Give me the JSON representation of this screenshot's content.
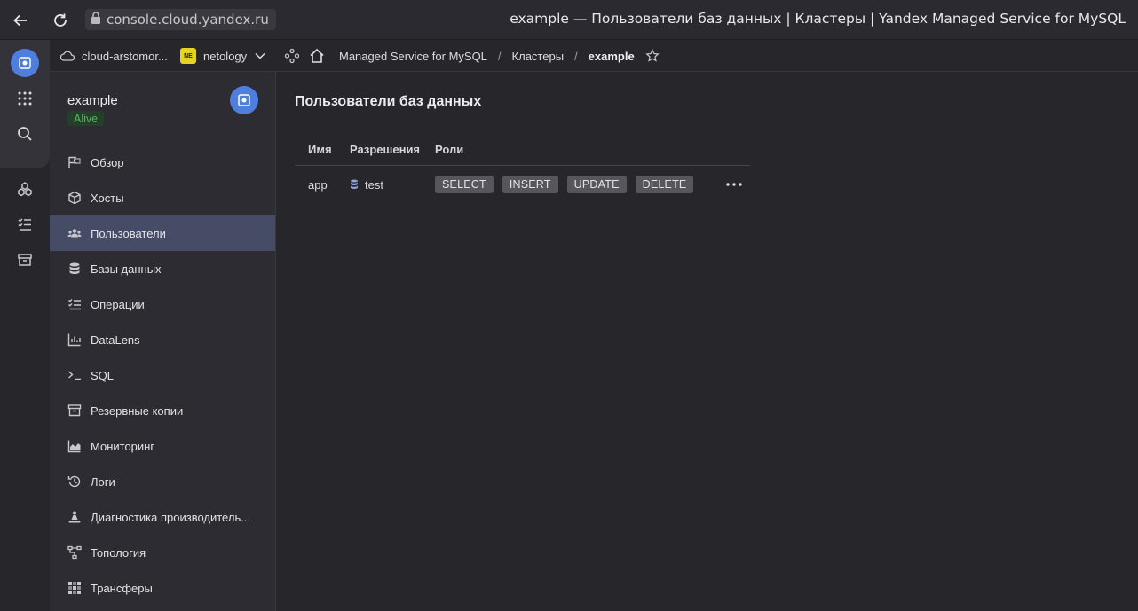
{
  "browser": {
    "url": "console.cloud.yandex.ru",
    "page_title": "example — Пользователи баз данных | Кластеры | Yandex Managed Service for MySQL"
  },
  "topbar": {
    "cloud": "cloud-arstomor...",
    "folder_badge": "NE",
    "folder": "netology",
    "breadcrumbs": [
      "Managed Service for MySQL",
      "Кластеры",
      "example"
    ],
    "separator": "/"
  },
  "cluster": {
    "name": "example",
    "status": "Alive"
  },
  "sidebar": {
    "items": [
      {
        "label": "Обзор",
        "icon": "flag-icon"
      },
      {
        "label": "Хосты",
        "icon": "cube-icon"
      },
      {
        "label": "Пользователи",
        "icon": "persons-icon",
        "active": true
      },
      {
        "label": "Базы данных",
        "icon": "database-icon"
      },
      {
        "label": "Операции",
        "icon": "list-check-icon"
      },
      {
        "label": "DataLens",
        "icon": "bar-chart-icon"
      },
      {
        "label": "SQL",
        "icon": "terminal-icon"
      },
      {
        "label": "Резервные копии",
        "icon": "archive-icon"
      },
      {
        "label": "Мониторинг",
        "icon": "chart-area-icon"
      },
      {
        "label": "Логи",
        "icon": "history-icon"
      },
      {
        "label": "Диагностика производитель...",
        "icon": "diagnostics-icon"
      },
      {
        "label": "Топология",
        "icon": "topology-icon"
      },
      {
        "label": "Трансферы",
        "icon": "transfer-icon"
      }
    ]
  },
  "main": {
    "title": "Пользователи баз данных",
    "columns": [
      "Имя",
      "Разрешения",
      "Роли"
    ],
    "rows": [
      {
        "name": "app",
        "permission": "test",
        "roles": [
          "SELECT",
          "INSERT",
          "UPDATE",
          "DELETE"
        ]
      }
    ]
  },
  "colors": {
    "accent": "#4f7fde",
    "alive": "#56b55e",
    "active_nav": "#464c66"
  }
}
